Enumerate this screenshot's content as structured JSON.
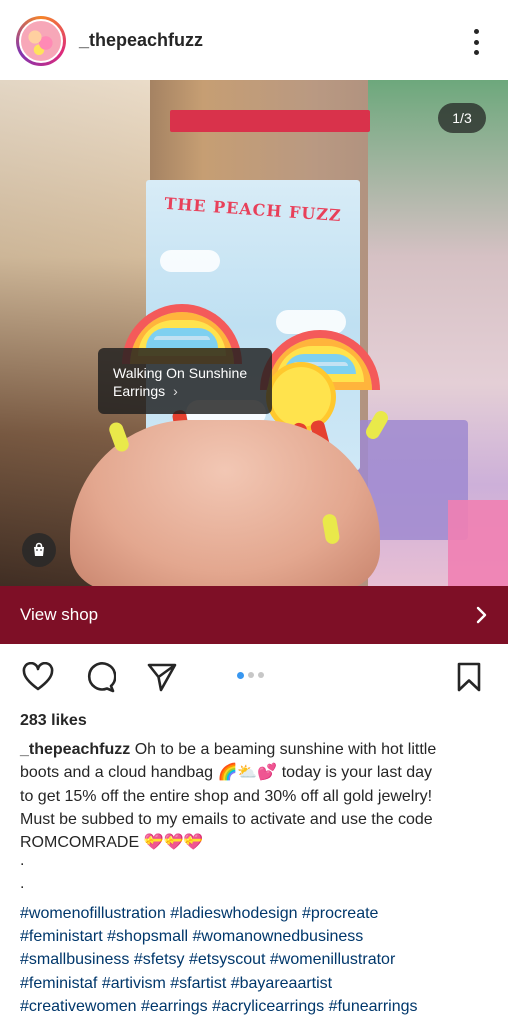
{
  "post": {
    "username": "_thepeachfuzz",
    "carousel_counter": "1/3",
    "card_title": "THE PEACH FUZZ",
    "product_tag": {
      "line1": "Walking On Sunshine",
      "line2": "Earrings",
      "chevron": "›"
    },
    "view_shop_label": "View shop",
    "likes": "283 likes",
    "caption": {
      "author": "_thepeachfuzz",
      "line1": " Oh to be a beaming sunshine with hot little",
      "line2": "boots and a cloud handbag 🌈⛅💕 today is your last day",
      "line3": "to get 15% off the entire shop and 30% off all gold jewelry!",
      "line4": "Must be subbed to my emails to activate and use the code",
      "line5": "ROMCOMRADE 💝💝💝",
      "dot1": ".",
      "dot2": "."
    },
    "hashtags": [
      "#womenofillustration #ladieswhodesign #procreate",
      "#feministart #shopsmall #womanownedbusiness",
      "#smallbusiness #sfetsy #etsyscout #womenillustrator",
      "#feministaf #artivism #sfartist #bayareaartist",
      "#creativewomen #earrings #acrylicearrings #funearrings"
    ],
    "carousel": {
      "current": 1,
      "total": 3
    }
  },
  "icons": {
    "more": "more-vertical-icon",
    "like": "heart-icon",
    "comment": "comment-icon",
    "share": "send-icon",
    "save": "bookmark-icon",
    "shop": "shopping-bag-icon",
    "view_shop_chevron": "chevron-right-icon"
  },
  "colors": {
    "shop_bar": "#7e0f26",
    "hashtag": "#00376b",
    "active_dot": "#3897f0"
  }
}
